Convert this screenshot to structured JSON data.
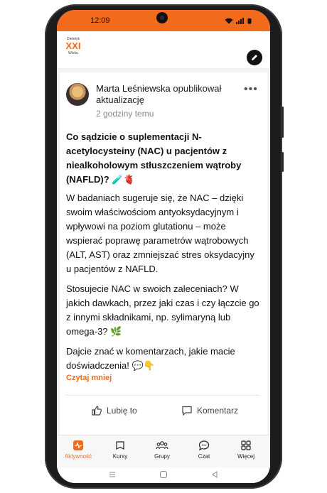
{
  "status": {
    "time": "12:09"
  },
  "brand": {
    "line1": "Dietetyk",
    "line2": "XXI",
    "line3": "Wieku"
  },
  "post": {
    "author_name": "Marta Leśniewska",
    "action": " opublikował aktualizację",
    "time_ago": "2 godziny temu",
    "title": "Co sądzicie o suplementacji N-acetylocysteiny (NAC) u pacjentów z niealkoholowym stłuszczeniem wątroby (NAFLD)? 🧪🫀",
    "p1": "W badaniach sugeruje się, że NAC – dzięki swoim właściwościom antyoksydacyjnym i wpływowi na poziom glutationu – może wspierać poprawę parametrów wątrobowych (ALT, AST) oraz zmniejszać stres oksydacyjny u pacjentów z NAFLD.",
    "p2": "Stosujecie NAC w swoich zaleceniach? W jakich dawkach, przez jaki czas i czy łączcie go z innymi składnikami, np. sylimaryną lub omega-3? 🌿",
    "p3": "Dajcie znać w komentarzach, jakie macie doświadczenia! 💬👇",
    "read_less": "Czytaj mniej",
    "like_label": "Lubię to",
    "comment_label": "Komentarz"
  },
  "tabs": [
    {
      "label": "Aktywność",
      "icon": "activity-icon",
      "active": true
    },
    {
      "label": "Kursy",
      "icon": "courses-icon"
    },
    {
      "label": "Grupy",
      "icon": "groups-icon"
    },
    {
      "label": "Czat",
      "icon": "chat-icon"
    },
    {
      "label": "Więcej",
      "icon": "more-grid-icon"
    }
  ],
  "colors": {
    "accent": "#f26a1b"
  }
}
